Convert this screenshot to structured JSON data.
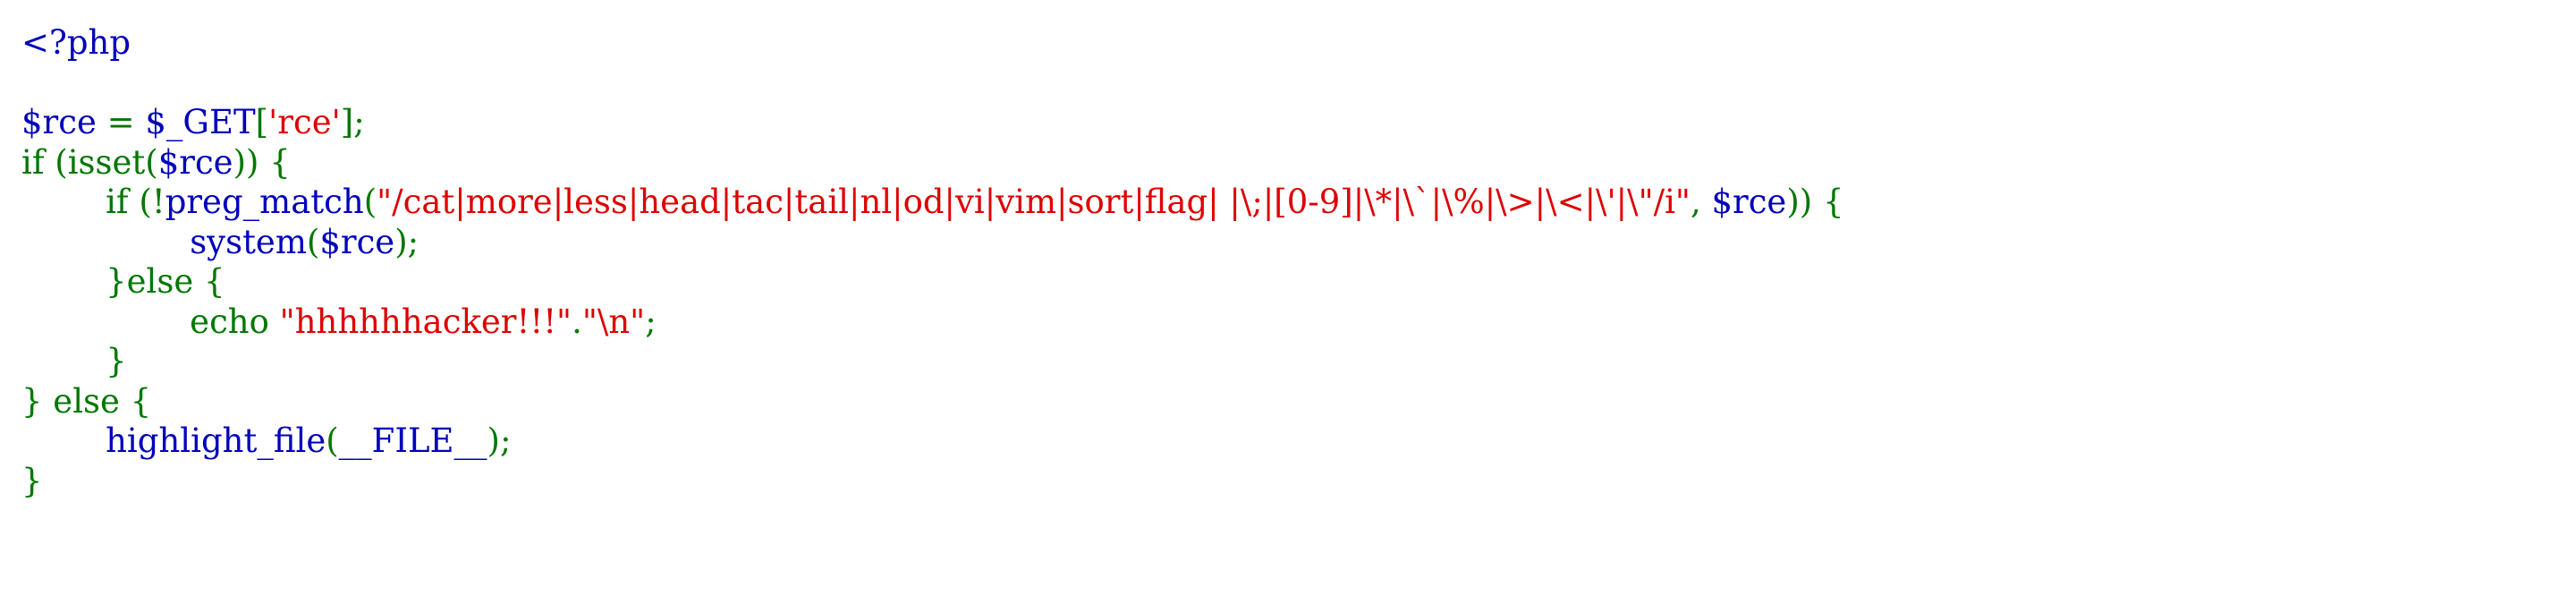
{
  "colors": {
    "default": "#0000BB",
    "keyword": "#007700",
    "string": "#DD0000",
    "background": "#FFFFFF"
  },
  "code_lines": [
    [
      {
        "t": "<?php",
        "c": "default"
      }
    ],
    [],
    [
      {
        "t": "$rce ",
        "c": "default"
      },
      {
        "t": "= ",
        "c": "keyword"
      },
      {
        "t": "$_GET",
        "c": "default"
      },
      {
        "t": "[",
        "c": "keyword"
      },
      {
        "t": "'rce'",
        "c": "string"
      },
      {
        "t": "];",
        "c": "keyword"
      }
    ],
    [
      {
        "t": "if (isset(",
        "c": "keyword"
      },
      {
        "t": "$rce",
        "c": "default"
      },
      {
        "t": ")) {",
        "c": "keyword"
      }
    ],
    [
      {
        "t": "    if (!",
        "c": "keyword"
      },
      {
        "t": "preg_match",
        "c": "default"
      },
      {
        "t": "(",
        "c": "keyword"
      },
      {
        "t": "\"/cat|more|less|head|tac|tail|nl|od|vi|vim|sort|flag| |\\;|[0-9]|\\*|\\`|\\%|\\>|\\<|\\'|\\\"/i\"",
        "c": "string"
      },
      {
        "t": ", ",
        "c": "keyword"
      },
      {
        "t": "$rce",
        "c": "default"
      },
      {
        "t": ")) {",
        "c": "keyword"
      }
    ],
    [
      {
        "t": "        ",
        "c": "keyword"
      },
      {
        "t": "system",
        "c": "default"
      },
      {
        "t": "(",
        "c": "keyword"
      },
      {
        "t": "$rce",
        "c": "default"
      },
      {
        "t": ");",
        "c": "keyword"
      }
    ],
    [
      {
        "t": "    }else {",
        "c": "keyword"
      }
    ],
    [
      {
        "t": "        echo ",
        "c": "keyword"
      },
      {
        "t": "\"hhhhhhacker!!!\"",
        "c": "string"
      },
      {
        "t": ".",
        "c": "keyword"
      },
      {
        "t": "\"\\n\"",
        "c": "string"
      },
      {
        "t": ";",
        "c": "keyword"
      }
    ],
    [
      {
        "t": "    }",
        "c": "keyword"
      }
    ],
    [
      {
        "t": "} else {",
        "c": "keyword"
      }
    ],
    [
      {
        "t": "    ",
        "c": "keyword"
      },
      {
        "t": "highlight_file",
        "c": "default"
      },
      {
        "t": "(",
        "c": "keyword"
      },
      {
        "t": "__FILE__",
        "c": "default"
      },
      {
        "t": ");",
        "c": "keyword"
      }
    ],
    [
      {
        "t": "}",
        "c": "keyword"
      }
    ]
  ]
}
